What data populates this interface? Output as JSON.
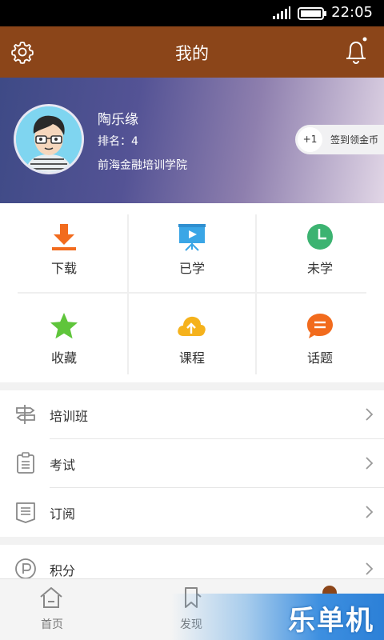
{
  "status_bar": {
    "time": "22:05"
  },
  "header": {
    "title": "我的"
  },
  "profile": {
    "name": "陶乐缘",
    "rank": "排名：4",
    "school": "前海金融培训学院",
    "checkin_badge": "+1",
    "checkin_label": "签到领金币"
  },
  "grid": [
    {
      "label": "下载",
      "icon": "download-icon",
      "color": "#f26b1d"
    },
    {
      "label": "已学",
      "icon": "video-board-icon",
      "color": "#3aa6e6"
    },
    {
      "label": "未学",
      "icon": "clock-icon",
      "color": "#3cb371"
    },
    {
      "label": "收藏",
      "icon": "star-icon",
      "color": "#5fc53b"
    },
    {
      "label": "课程",
      "icon": "cloud-upload-icon",
      "color": "#f5b21c"
    },
    {
      "label": "话题",
      "icon": "chat-bubble-icon",
      "color": "#f26b1d"
    }
  ],
  "menu": [
    {
      "label": "培训班",
      "icon": "signpost-icon"
    },
    {
      "label": "考试",
      "icon": "clipboard-icon"
    },
    {
      "label": "订阅",
      "icon": "document-list-icon"
    },
    {
      "label": "积分",
      "icon": "points-icon"
    }
  ],
  "tabbar": [
    {
      "label": "首页",
      "icon": "home-icon"
    },
    {
      "label": "发现",
      "icon": "bookmark-icon"
    }
  ],
  "watermark": {
    "text": "乐单机"
  },
  "colors": {
    "header": "#8b4519",
    "accent_orange": "#f26b1d"
  }
}
